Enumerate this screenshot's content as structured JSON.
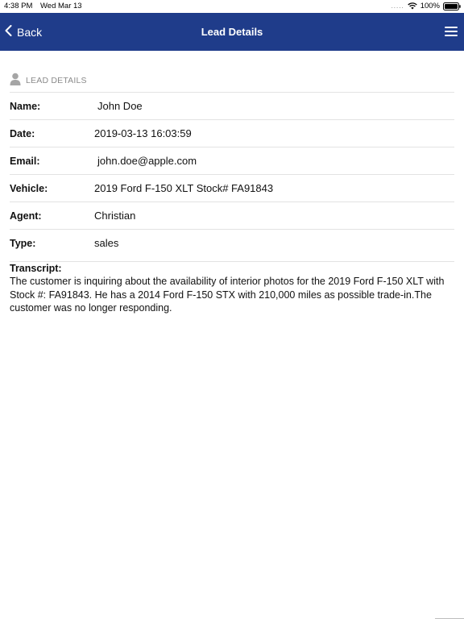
{
  "status_bar": {
    "time": "4:38 PM",
    "date": "Wed Mar 13",
    "signal": ".....",
    "battery": "100%"
  },
  "nav": {
    "back_label": "Back",
    "title": "Lead Details",
    "menu_icon": "hamburger-menu-icon",
    "color": "#1f3c8a"
  },
  "section": {
    "icon": "person-icon",
    "title": "LEAD DETAILS"
  },
  "rows": [
    {
      "label": "Name:",
      "value": "John Doe"
    },
    {
      "label": "Date:",
      "value": "2019-03-13 16:03:59"
    },
    {
      "label": "Email:",
      "value": "john.doe@apple.com"
    },
    {
      "label": "Vehicle:",
      "value": "2019 Ford F-150 XLT Stock# FA91843"
    },
    {
      "label": "Agent:",
      "value": "Christian"
    },
    {
      "label": "Type:",
      "value": "sales"
    }
  ],
  "transcript": {
    "label": "Transcript:",
    "text": "The customer is inquiring about the availability of interior photos for the 2019 Ford F-150 XLT with Stock #: FA91843. He has a 2014 Ford F-150 STX with 210,000 miles as possible trade-in.The customer was no longer responding."
  }
}
